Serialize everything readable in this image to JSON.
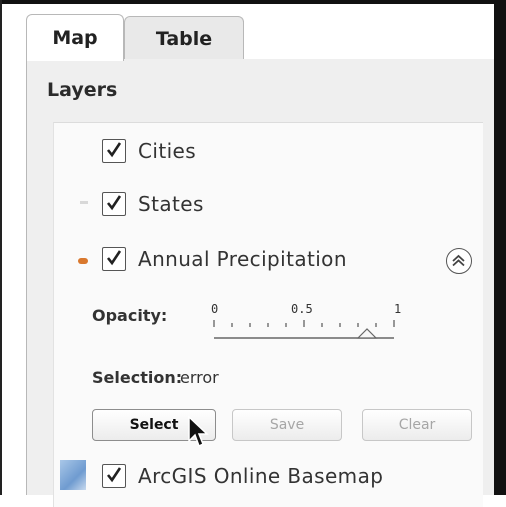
{
  "tabs": [
    {
      "label": "Map",
      "active": true
    },
    {
      "label": "Table",
      "active": false
    }
  ],
  "panel": {
    "title": "Layers",
    "layers": [
      {
        "label": "Cities",
        "checked": true,
        "swatch": "none"
      },
      {
        "label": "States",
        "checked": true,
        "swatch": "line-light"
      },
      {
        "label": "Annual Precipitation",
        "checked": true,
        "swatch": "orange-dot",
        "expanded": true
      },
      {
        "label": "ArcGIS Online Basemap",
        "checked": true,
        "swatch": "basemap-thumbnail"
      }
    ],
    "opacity": {
      "label": "Opacity:",
      "ticks": [
        "0",
        "0.5",
        "1"
      ],
      "value": 0.85
    },
    "selection": {
      "label": "Selection:",
      "value": "error"
    },
    "buttons": {
      "select": "Select",
      "save": "Save",
      "clear": "Clear"
    }
  },
  "colors": {
    "panel_bg": "#efefef",
    "inner_bg": "#fafafa",
    "precip_swatch": "#d9782e",
    "basemap_swatch": "#7fa8d6"
  },
  "icons": [
    "checkmark-icon",
    "collapse-up-icon",
    "mouse-pointer-icon"
  ]
}
